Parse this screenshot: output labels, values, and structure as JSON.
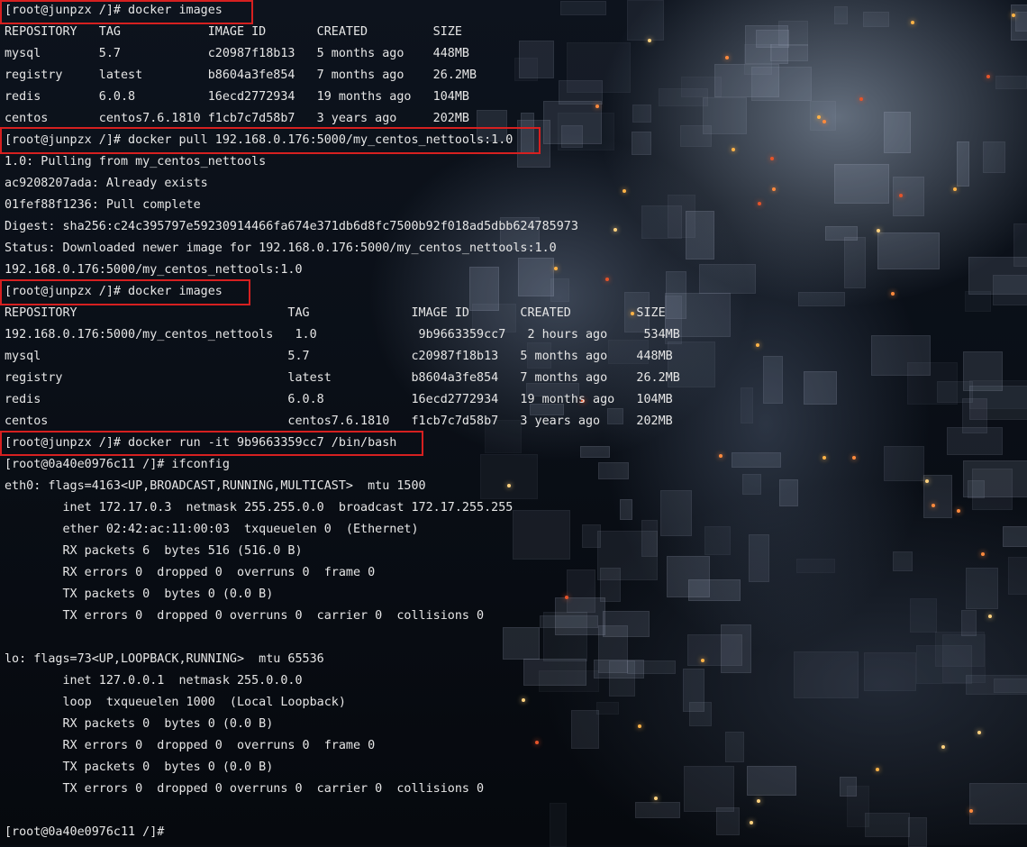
{
  "terminal": {
    "lines": [
      "[root@junpzx /]# docker images",
      "REPOSITORY   TAG            IMAGE ID       CREATED         SIZE",
      "mysql        5.7            c20987f18b13   5 months ago    448MB",
      "registry     latest         b8604a3fe854   7 months ago    26.2MB",
      "redis        6.0.8          16ecd2772934   19 months ago   104MB",
      "centos       centos7.6.1810 f1cb7c7d58b7   3 years ago     202MB",
      "[root@junpzx /]# docker pull 192.168.0.176:5000/my_centos_nettools:1.0",
      "1.0: Pulling from my_centos_nettools",
      "ac9208207ada: Already exists",
      "01fef88f1236: Pull complete",
      "Digest: sha256:c24c395797e59230914466fa674e371db6d8fc7500b92f018ad5dbb624785973",
      "Status: Downloaded newer image for 192.168.0.176:5000/my_centos_nettools:1.0",
      "192.168.0.176:5000/my_centos_nettools:1.0",
      "[root@junpzx /]# docker images",
      "REPOSITORY                             TAG              IMAGE ID       CREATED         SIZE",
      "192.168.0.176:5000/my_centos_nettools   1.0              9b9663359cc7   2 hours ago     534MB",
      "mysql                                  5.7              c20987f18b13   5 months ago    448MB",
      "registry                               latest           b8604a3fe854   7 months ago    26.2MB",
      "redis                                  6.0.8            16ecd2772934   19 months ago   104MB",
      "centos                                 centos7.6.1810   f1cb7c7d58b7   3 years ago     202MB",
      "[root@junpzx /]# docker run -it 9b9663359cc7 /bin/bash",
      "[root@0a40e0976c11 /]# ifconfig",
      "eth0: flags=4163<UP,BROADCAST,RUNNING,MULTICAST>  mtu 1500",
      "        inet 172.17.0.3  netmask 255.255.0.0  broadcast 172.17.255.255",
      "        ether 02:42:ac:11:00:03  txqueuelen 0  (Ethernet)",
      "        RX packets 6  bytes 516 (516.0 B)",
      "        RX errors 0  dropped 0  overruns 0  frame 0",
      "        TX packets 0  bytes 0 (0.0 B)",
      "        TX errors 0  dropped 0 overruns 0  carrier 0  collisions 0",
      "",
      "lo: flags=73<UP,LOOPBACK,RUNNING>  mtu 65536",
      "        inet 127.0.0.1  netmask 255.0.0.0",
      "        loop  txqueuelen 1000  (Local Loopback)",
      "        RX packets 0  bytes 0 (0.0 B)",
      "        RX errors 0  dropped 0  overruns 0  frame 0",
      "        TX packets 0  bytes 0 (0.0 B)",
      "        TX errors 0  dropped 0 overruns 0  carrier 0  collisions 0",
      "",
      "[root@0a40e0976c11 /]#"
    ]
  },
  "colors": {
    "text": "#e6e6e6",
    "highlight_box": "#d62020",
    "background": "#070b12"
  }
}
